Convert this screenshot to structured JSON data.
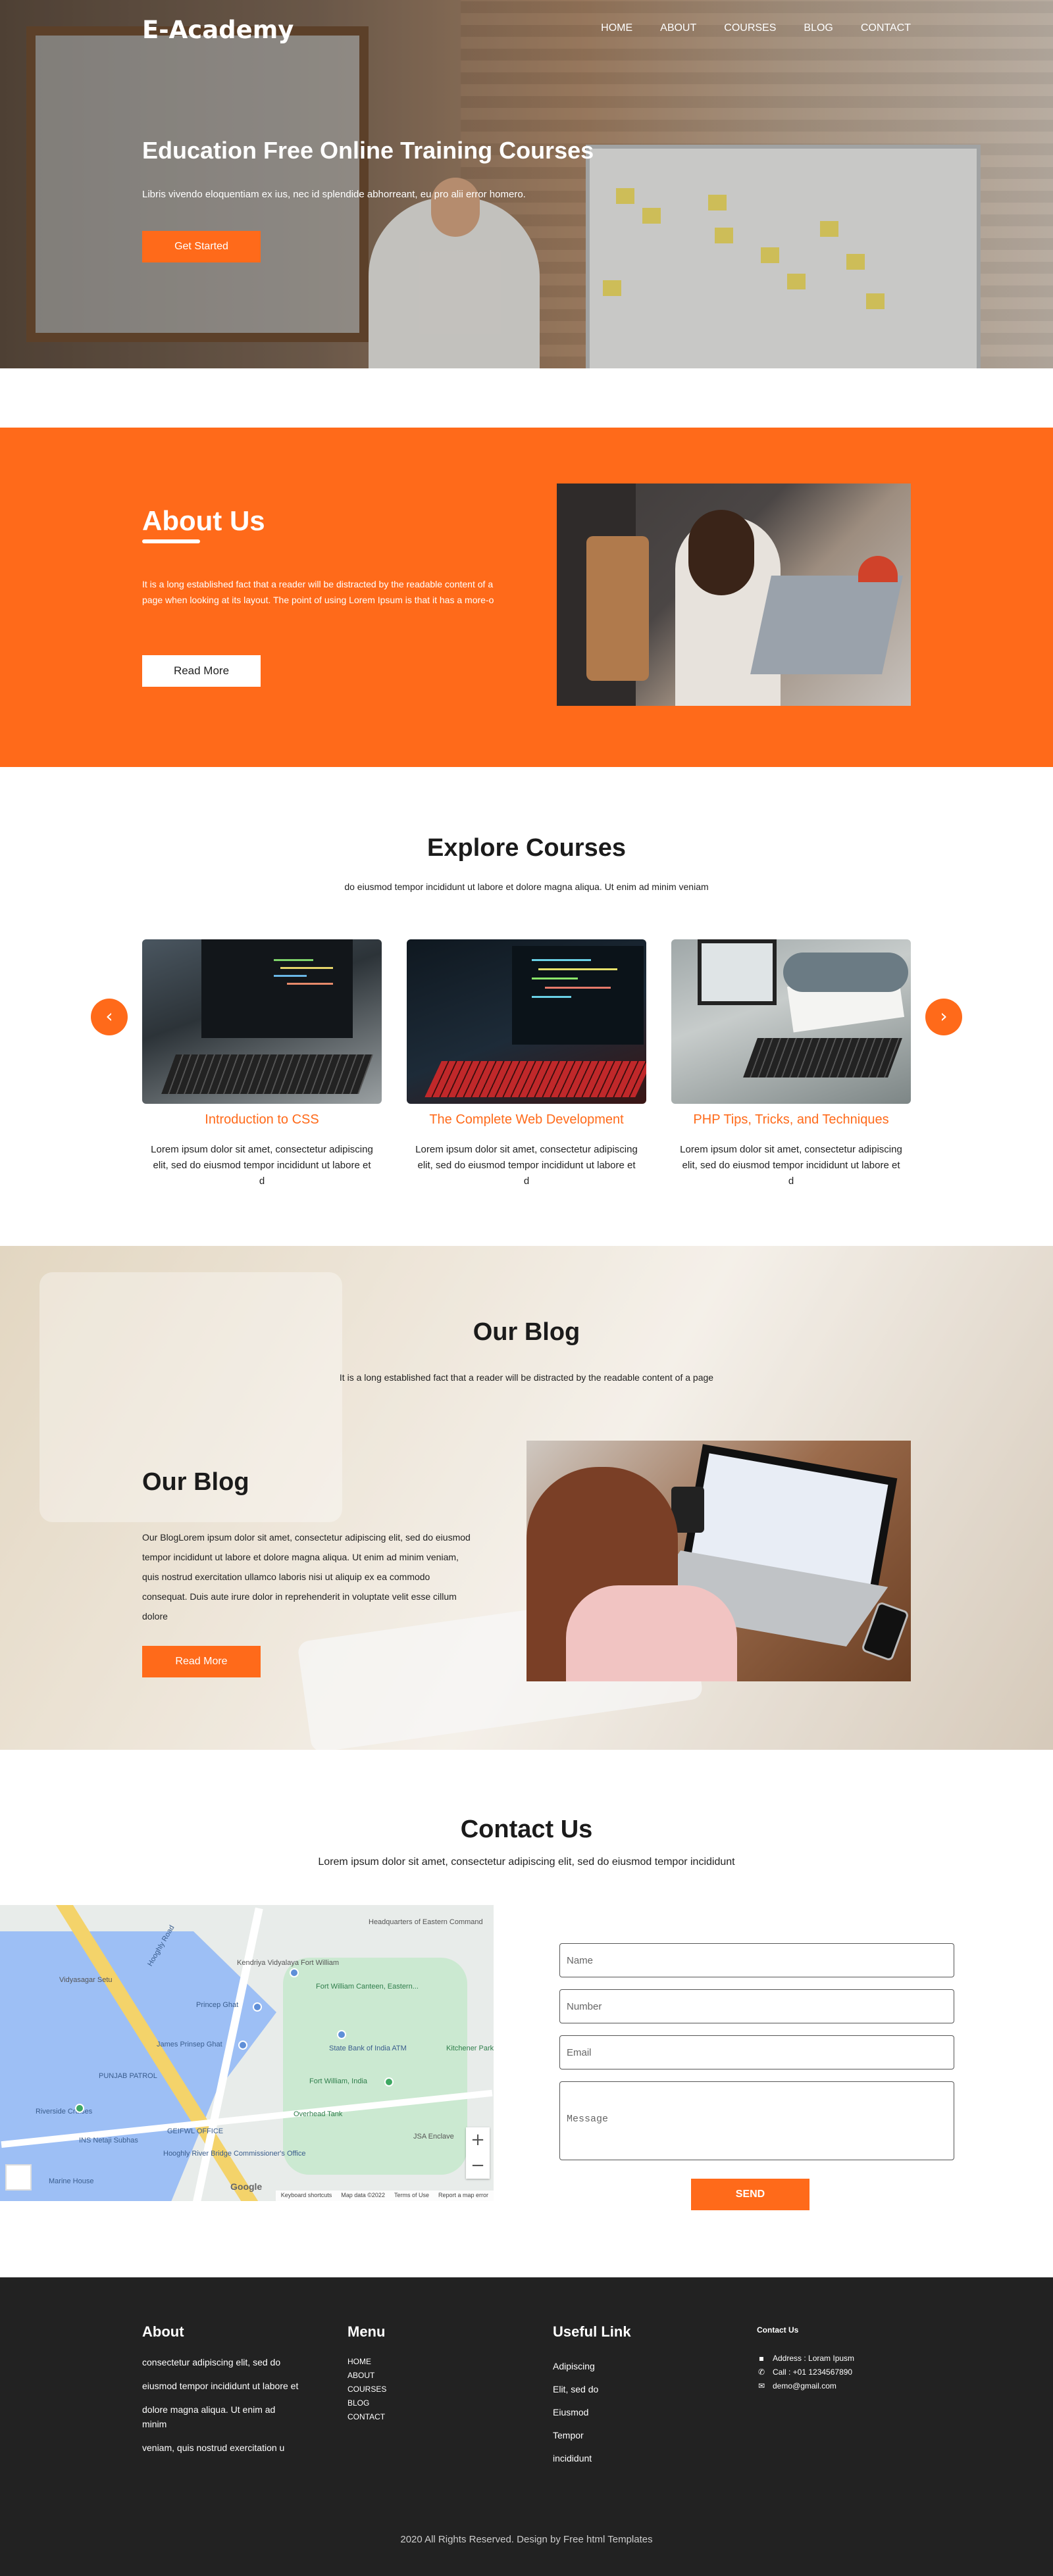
{
  "header": {
    "logo": "E-Academy",
    "nav": [
      "HOME",
      "ABOUT",
      "COURSES",
      "BLOG",
      "CONTACT"
    ]
  },
  "hero": {
    "title": "Education Free Online Training Courses",
    "text": "Libris vivendo eloquentiam ex ius, nec id splendide abhorreant, eu pro alii error homero.",
    "button": "Get Started"
  },
  "about": {
    "title": "About Us",
    "text": "It is a long established fact that a reader will be distracted by the readable content of a page when looking at its layout. The point of using Lorem Ipsum is that it has a more-o",
    "button": "Read More"
  },
  "courses": {
    "title": "Explore Courses",
    "subtitle": "do eiusmod tempor incididunt ut labore et dolore magna aliqua. Ut enim ad minim veniam",
    "prev_icon": "chevron-left-icon",
    "next_icon": "chevron-right-icon",
    "items": [
      {
        "title": "Introduction to CSS",
        "text": "Lorem ipsum dolor sit amet, consectetur adipiscing elit, sed do eiusmod tempor incididunt ut labore et d"
      },
      {
        "title": "The Complete Web Development",
        "text": "Lorem ipsum dolor sit amet, consectetur adipiscing elit, sed do eiusmod tempor incididunt ut labore et d"
      },
      {
        "title": "PHP Tips, Tricks, and Techniques",
        "text": "Lorem ipsum dolor sit amet, consectetur adipiscing elit, sed do eiusmod tempor incididunt ut labore et d"
      }
    ]
  },
  "blog": {
    "title": "Our Blog",
    "subtitle": "It is a long established fact that a reader will be distracted by the readable content of a page",
    "heading": "Our Blog",
    "text": "Our BlogLorem ipsum dolor sit amet, consectetur adipiscing elit, sed do eiusmod tempor incididunt ut labore et dolore magna aliqua. Ut enim ad minim veniam, quis nostrud exercitation ullamco laboris nisi ut aliquip ex ea commodo consequat. Duis aute irure dolor in reprehenderit in voluptate velit esse cillum dolore",
    "button": "Read More"
  },
  "contact": {
    "title": "Contact Us",
    "subtitle": "Lorem ipsum dolor sit amet, consectetur adipiscing elit, sed do eiusmod tempor incididunt",
    "map": {
      "labels": {
        "hq": "Headquarters of Eastern Command",
        "kv": "Kendriya Vidyalaya Fort William",
        "vs": "Vidyasagar Setu",
        "pg": "Princep Ghat",
        "fwc": "Fort William Canteen, Eastern...",
        "jpg": "James Prinsep Ghat",
        "sbi": "State Bank of India ATM",
        "kc": "Kitchener Park",
        "fw": "Fort William, India",
        "pd": "PUNJAB PATROL",
        "ot": "Overhead Tank",
        "gpo": "GEIFWL OFFICE",
        "rc": "Riverside Cruises",
        "nb": "INS Netaji Subhas",
        "hr": "Hooghly River Bridge Commissioner's Office",
        "mh": "Marine House",
        "ja": "JSA Enclave",
        "hs": "Hooghly Road"
      },
      "attrib": [
        "Keyboard shortcuts",
        "Map data ©2022",
        "Terms of Use",
        "Report a map error"
      ],
      "google": "Google"
    },
    "placeholders": {
      "name": "Name",
      "number": "Number",
      "email": "Email",
      "message": "Message"
    },
    "send": "SEND"
  },
  "footer": {
    "about_title": "About",
    "about_lines": [
      "consectetur adipiscing elit, sed do",
      "eiusmod tempor incididunt ut labore et",
      "dolore magna aliqua. Ut enim ad minim",
      "veniam, quis nostrud exercitation u"
    ],
    "menu_title": "Menu",
    "menu": [
      "HOME",
      "ABOUT",
      "COURSES",
      "BLOG",
      "CONTACT"
    ],
    "links_title": "Useful Link",
    "links": [
      "Adipiscing",
      "Elit, sed do",
      "Eiusmod",
      "Tempor",
      "incididunt"
    ],
    "contact_title": "Contact Us",
    "contact": [
      {
        "icon": "map-marker-icon",
        "text": "Address : Loram Ipusm"
      },
      {
        "icon": "phone-icon",
        "text": "Call : +01 1234567890"
      },
      {
        "icon": "envelope-icon",
        "text": "demo@gmail.com"
      }
    ],
    "copyright": "2020 All Rights Reserved. Design by Free html Templates"
  }
}
